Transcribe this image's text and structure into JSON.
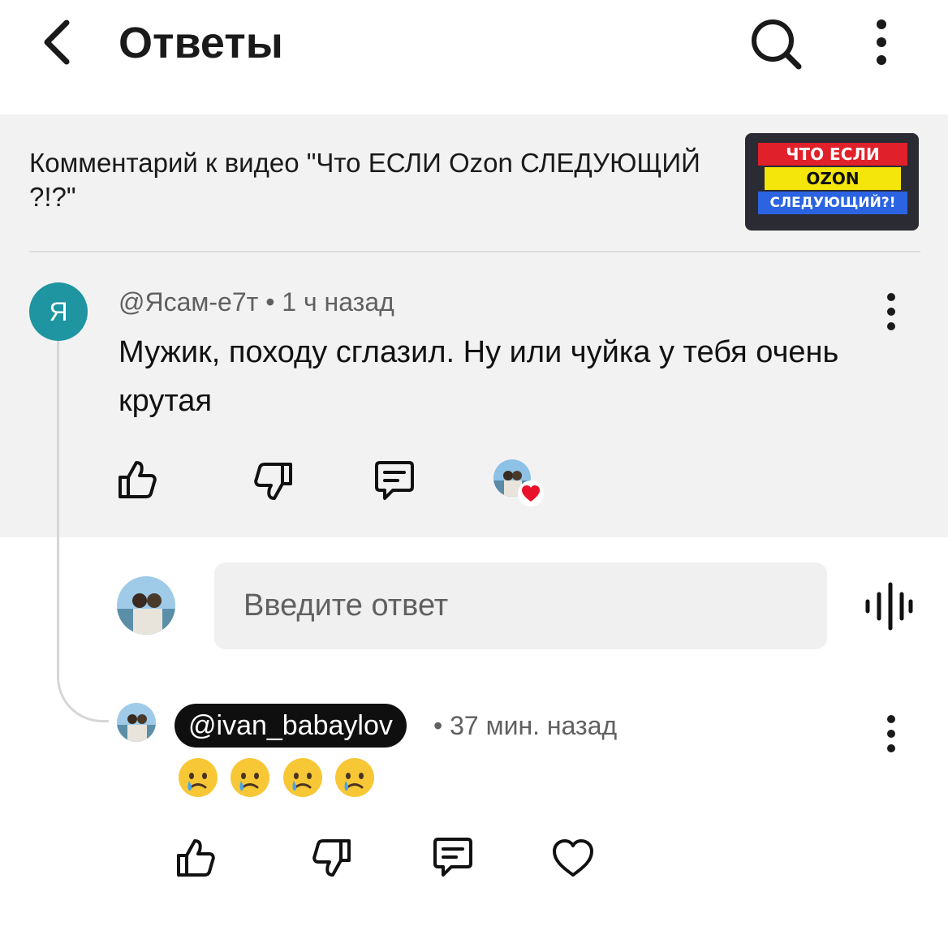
{
  "header": {
    "title": "Ответы",
    "back_icon": "chevron-left-icon",
    "search_icon": "search-icon",
    "menu_icon": "more-vert-icon"
  },
  "video": {
    "caption": "Комментарий к видео \"Что ЕСЛИ Ozon СЛЕДУЮЩИЙ ?!?\"",
    "thumbnail": {
      "line1": "ЧТО ЕСЛИ",
      "line2": "OZON",
      "line3": "СЛЕДУЮЩИЙ?!"
    }
  },
  "comment": {
    "avatar_letter": "Я",
    "author": "@Ясам-е7т",
    "separator": "•",
    "time": "1 ч назад",
    "text": "Мужик, походу сглазил. Ну или чуйка у тебя очень крутая",
    "actions": [
      "thumbs-up-icon",
      "thumbs-down-icon",
      "reply-icon",
      "creator-heart-icon"
    ]
  },
  "reply_input": {
    "placeholder": "Введите ответ",
    "voice_icon": "voice-input-icon"
  },
  "reply": {
    "mention": "@ivan_babaylov",
    "separator": "•",
    "time": "37 мин. назад",
    "emoji_text": "😢😢😢😢",
    "actions": [
      "thumbs-up-icon",
      "thumbs-down-icon",
      "reply-icon",
      "heart-icon"
    ]
  },
  "colors": {
    "avatar_bg": "#1e95a0",
    "comment_bg": "#f2f2f2",
    "heart_red": "#e8122a",
    "thumb_red": "#e0202a",
    "thumb_yellow": "#f4e60a",
    "thumb_blue": "#2b63e0"
  }
}
